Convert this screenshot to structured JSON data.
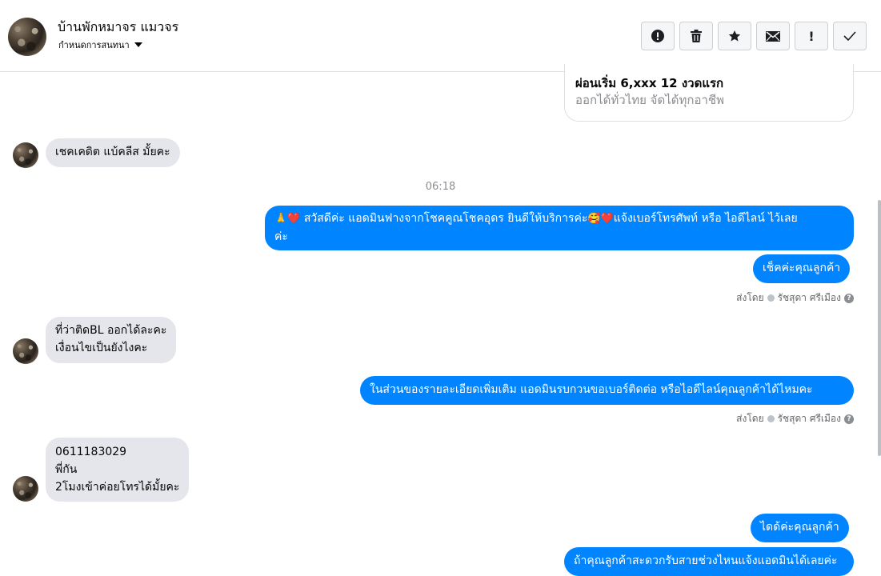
{
  "header": {
    "page_name": "บ้านพักหมาจร แมวจร",
    "conversation_label": "กำหนดการสนทนา",
    "actions": [
      {
        "name": "spam-report-icon",
        "glyph": "!"
      },
      {
        "name": "trash-icon",
        "glyph": "🗑"
      },
      {
        "name": "star-icon",
        "glyph": "★"
      },
      {
        "name": "mail-icon",
        "glyph": "✉"
      },
      {
        "name": "important-icon",
        "glyph": "!"
      },
      {
        "name": "check-icon",
        "glyph": "✓"
      }
    ]
  },
  "card": {
    "title": "ผ่อนเริ่ม 6,xxx 12 งวดแรก",
    "subtitle": "ออกได้ทั่วไทย จัดได้ทุกอาชีพ"
  },
  "messages": {
    "m1": "เชคเคดิต แบ้คลีส มั้ยคะ",
    "timestamp": "06:18",
    "m2_emoji_pre": "🙏❤️",
    "m2_line1": " สวัสดีค่ะ แอดมินฟางจากโชคคูณโชคอุดร ยินดีให้บริการค่ะ",
    "m2_emoji_mid": "🥰❤️",
    "m2_line1b": "แจ้งเบอร์โทรศัพท์ หรือ ไอดีไลน์  ไว้เลย",
    "m2_line2": "ค่ะ",
    "m3": "เช็คค่ะคุณลูกค้า",
    "m4_line1": "ที่ว่าติดBL ออกได้ละคะ",
    "m4_line2": "เงื่อนไขเป็นยังไงคะ",
    "m5": "ในส่วนของรายละเอียดเพิ่มเติม แอดมินรบกวนขอเบอร์ติดต่อ หรือไอดีไลน์คุณลูกค้าได้ไหมคะ",
    "m6_line1": "0611183029",
    "m6_line2": "พี่กัน",
    "m6_line3": "2โมงเข้าค่อยโทรได้มั้ยคะ",
    "m7": "ไดด้ค่ะคุณลูกค้า",
    "m8_partial": "ถ้าคุณลูกค้าสะดวกรับสายช่วงไหนแจ้งแอดมินได้เลยค่ะ"
  },
  "sent_by": {
    "prefix": "ส่งโดย",
    "name": "รัชสุดา ศรีเมือง",
    "help": "?"
  }
}
